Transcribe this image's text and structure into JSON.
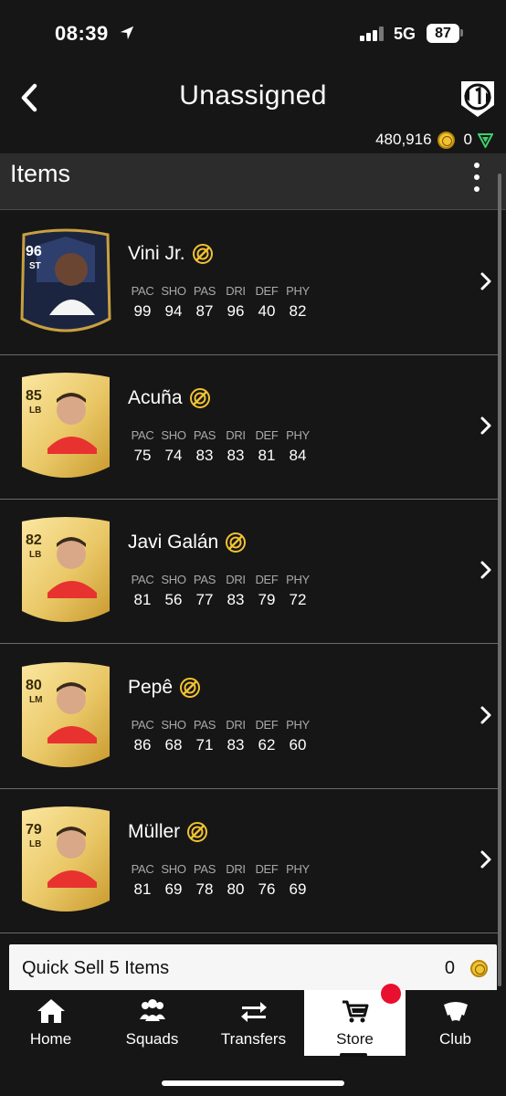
{
  "status": {
    "time": "08:39",
    "network": "5G",
    "battery": "87"
  },
  "header": {
    "title": "Unassigned",
    "coins": "480,916",
    "points": "0"
  },
  "items": {
    "label": "Items",
    "players": [
      {
        "name": "Vini Jr.",
        "rating": "96",
        "position": "ST",
        "stats": [
          "99",
          "94",
          "87",
          "96",
          "40",
          "82"
        ]
      },
      {
        "name": "Acuña",
        "rating": "85",
        "position": "LB",
        "stats": [
          "75",
          "74",
          "83",
          "83",
          "81",
          "84"
        ]
      },
      {
        "name": "Javi Galán",
        "rating": "82",
        "position": "LB",
        "stats": [
          "81",
          "56",
          "77",
          "83",
          "79",
          "72"
        ]
      },
      {
        "name": "Pepê",
        "rating": "80",
        "position": "LM",
        "stats": [
          "86",
          "68",
          "71",
          "83",
          "62",
          "60"
        ]
      },
      {
        "name": "Müller",
        "rating": "79",
        "position": "LB",
        "stats": [
          "81",
          "69",
          "78",
          "80",
          "76",
          "69"
        ]
      }
    ],
    "stat_labels": [
      "PAC",
      "SHO",
      "PAS",
      "DRI",
      "DEF",
      "PHY"
    ]
  },
  "quick_sell": {
    "label": "Quick Sell 5 Items",
    "value": "0"
  },
  "tabs": [
    {
      "label": "Home",
      "icon": "home-icon"
    },
    {
      "label": "Squads",
      "icon": "squads-icon"
    },
    {
      "label": "Transfers",
      "icon": "transfers-icon"
    },
    {
      "label": "Store",
      "icon": "store-icon"
    },
    {
      "label": "Club",
      "icon": "club-icon"
    }
  ],
  "colors": {
    "accent_gold": "#f1c232",
    "notification": "#e8102e",
    "points_green": "#3ecf6a"
  }
}
